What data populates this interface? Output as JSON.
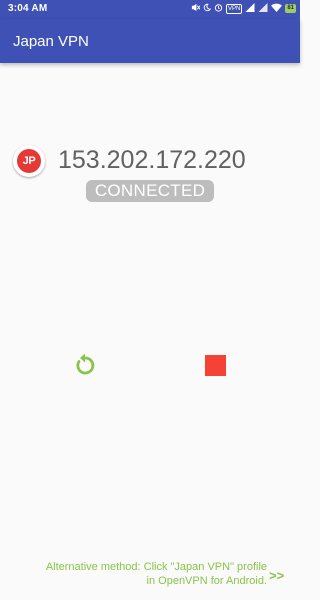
{
  "status_bar": {
    "time": "3:04 AM",
    "vpn_badge": "VPN",
    "battery_level": "81",
    "icons": [
      "mute-icon",
      "moon-icon",
      "alarm-icon",
      "vpn-icon",
      "signal-icon",
      "signal-icon",
      "wifi-icon",
      "battery-icon"
    ]
  },
  "app_bar": {
    "title": "Japan VPN"
  },
  "server": {
    "flag_label": "JP",
    "ip": "153.202.172.220",
    "status": "CONNECTED"
  },
  "controls": {
    "reconnect_icon": "refresh-icon",
    "stop_icon": "stop-icon"
  },
  "footer": {
    "alternative_line1": "Alternative method: Click \"Japan VPN\" profile",
    "alternative_line2": "in OpenVPN for Android.",
    "arrow": ">>"
  },
  "colors": {
    "primary": "#3f51b5",
    "flag_red": "#e53935",
    "accent_green": "#8bc34a",
    "stop_red": "#f44336",
    "pill_gray": "#bdbdbd"
  }
}
